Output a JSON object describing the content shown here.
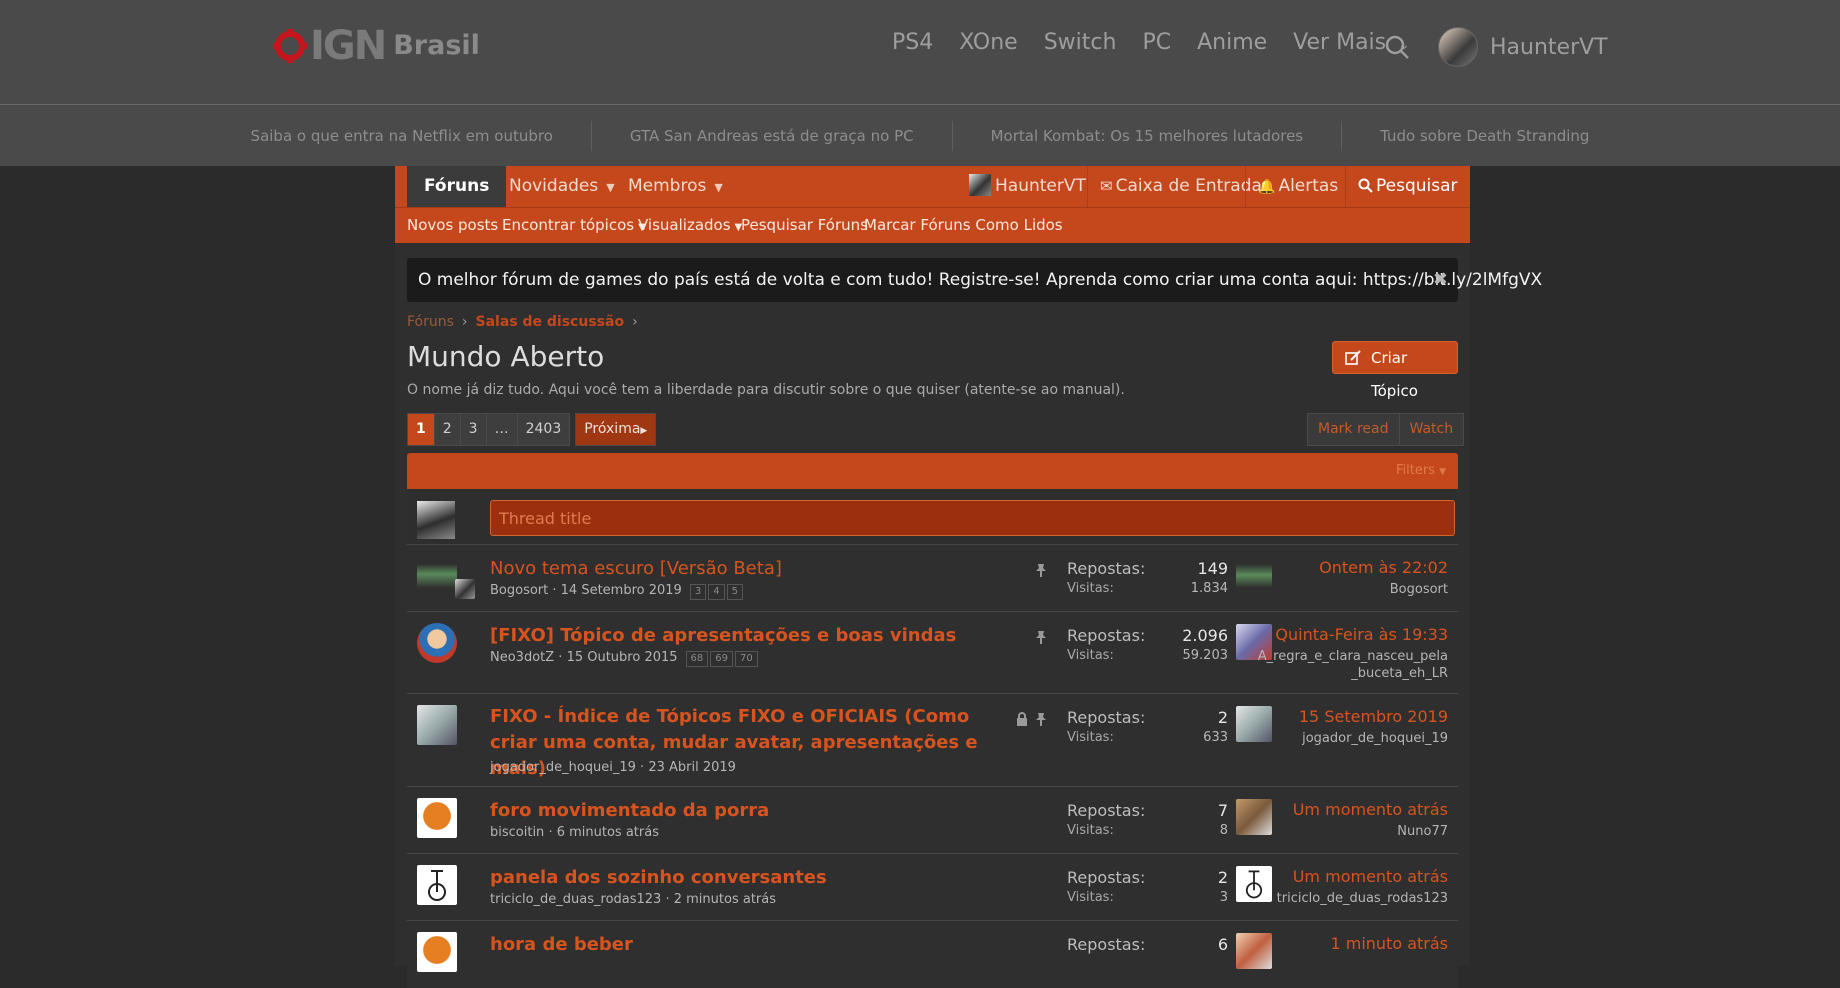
{
  "site": {
    "logo_text": "IGN",
    "logo_sub": "Brasil",
    "nav": [
      "PS4",
      "XOne",
      "Switch",
      "PC",
      "Anime"
    ],
    "more_label": "Ver Mais",
    "username": "HaunterVT"
  },
  "trending": [
    "Saiba o que entra na Netflix em outubro",
    "GTA San Andreas está de graça no PC",
    "Mortal Kombat: Os 15 melhores lutadores",
    "Tudo sobre Death Stranding"
  ],
  "forum_nav": {
    "tabs": {
      "forums": "Fóruns",
      "news": "Novidades",
      "members": "Membros"
    },
    "user": "HaunterVT",
    "inbox": "Caixa de Entrada",
    "alerts": "Alertas",
    "search": "Pesquisar"
  },
  "sub_nav": [
    "Novos posts",
    "Encontrar tópicos",
    "Visualizados",
    "Pesquisar Fóruns",
    "Marcar Fóruns Como Lidos"
  ],
  "notice": {
    "text": "O melhor fórum de games do país está de volta e com tudo! Registre-se! Aprenda como criar uma conta aqui: https://bit.ly/2lMfgVX",
    "close": "✖"
  },
  "breadcrumb": {
    "root": "Fóruns",
    "section": "Salas de discussão"
  },
  "page": {
    "title": "Mundo Aberto",
    "description": "O nome já diz tudo. Aqui você tem a liberdade para discutir sobre o que quiser (atente-se ao manual).",
    "create_label": "Criar Tópico"
  },
  "pagination": {
    "pages": [
      "1",
      "2",
      "3",
      "…",
      "2403"
    ],
    "next": "Próxima",
    "mark_read": "Mark read",
    "watch": "Watch"
  },
  "filters_label": "Filters",
  "thread_input_placeholder": "Thread title",
  "labels": {
    "replies": "Repostas:",
    "views": "Visitas:"
  },
  "threads": [
    {
      "title": "Novo tema escuro [Versão Beta]",
      "author": "Bogosort",
      "date": "14 Setembro 2019",
      "pages": [
        "3",
        "4",
        "5"
      ],
      "replies": "149",
      "views": "1.834",
      "last_time": "Ontem às 22:02",
      "last_user": "Bogosort"
    },
    {
      "title": "[FIXO] Tópico de apresentações e boas vindas",
      "author": "Neo3dotZ",
      "date": "15 Outubro 2015",
      "pages": [
        "68",
        "69",
        "70"
      ],
      "replies": "2.096",
      "views": "59.203",
      "last_time": "Quinta-Feira às 19:33",
      "last_user_1": "A_regra_e_clara_nasceu_pela",
      "last_user_2": "_buceta_eh_LR"
    },
    {
      "title": "FIXO - Índice de Tópicos FIXO e OFICIAIS (Como criar uma conta, mudar avatar, apresentações e mais)",
      "author": "jogador_de_hoquei_19",
      "date": "23 Abril 2019",
      "replies": "2",
      "views": "633",
      "last_time": "15 Setembro 2019",
      "last_user": "jogador_de_hoquei_19"
    },
    {
      "title": "foro movimentado da porra",
      "author": "biscoitin",
      "date": "6 minutos atrás",
      "replies": "7",
      "views": "8",
      "last_time": "Um momento atrás",
      "last_user": "Nuno77"
    },
    {
      "title": "panela dos sozinho conversantes",
      "author": "triciclo_de_duas_rodas123",
      "date": "2 minutos atrás",
      "replies": "2",
      "views": "3",
      "last_time": "Um momento atrás",
      "last_user": "triciclo_de_duas_rodas123"
    },
    {
      "title": "hora de beber",
      "replies": "6",
      "last_time": "1 minuto atrás"
    }
  ],
  "colors": {
    "accent": "#c4481c",
    "header_bg": "#4a4a4a",
    "page_bg": "#2b2b2b"
  }
}
